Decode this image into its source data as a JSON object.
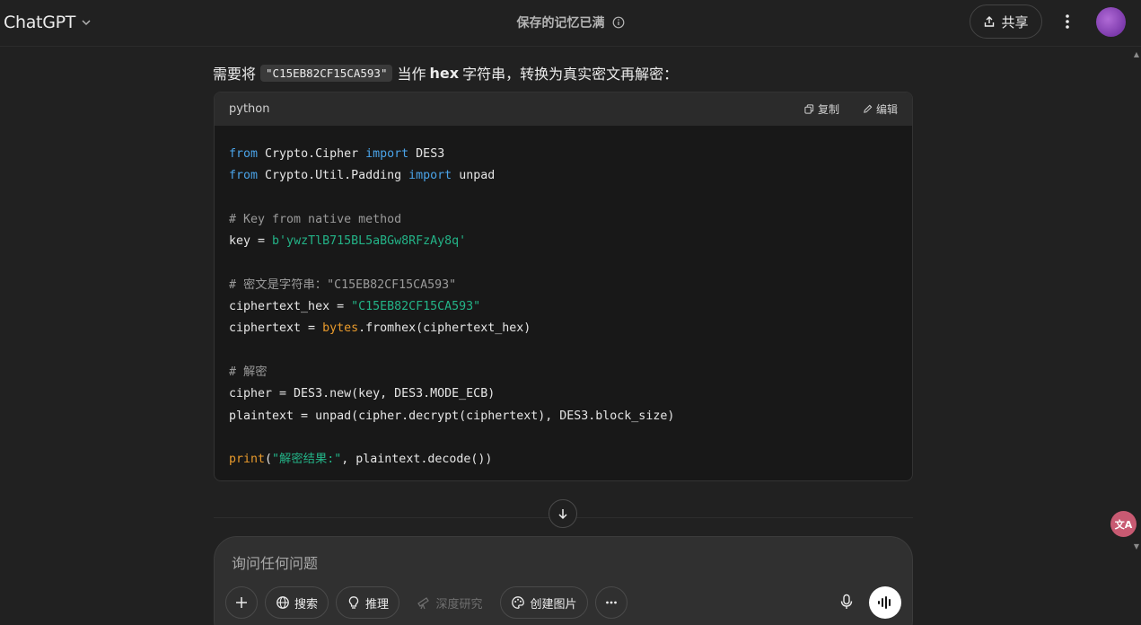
{
  "header": {
    "brand": "ChatGPT",
    "center_title": "保存的记忆已满",
    "share_label": "共享"
  },
  "message": {
    "intro_prefix": "需要将",
    "intro_code": "\"C15EB82CF15CA593\"",
    "intro_mid": "当作",
    "intro_bold": "hex",
    "intro_suffix": "字符串，转换为真实密文再解密："
  },
  "codeblock": {
    "language": "python",
    "copy_label": "复制",
    "edit_label": "编辑",
    "lines": [
      [
        {
          "t": "from",
          "c": "kw"
        },
        {
          "t": " Crypto.Cipher "
        },
        {
          "t": "import",
          "c": "kw"
        },
        {
          "t": " DES3"
        }
      ],
      [
        {
          "t": "from",
          "c": "kw"
        },
        {
          "t": " Crypto.Util.Padding "
        },
        {
          "t": "import",
          "c": "kw"
        },
        {
          "t": " unpad"
        }
      ],
      [],
      [
        {
          "t": "# Key from native method",
          "c": "cm"
        }
      ],
      [
        {
          "t": "key = "
        },
        {
          "t": "b'ywzTlB715BL5aBGw8RFzAy8q'",
          "c": "str"
        }
      ],
      [],
      [
        {
          "t": "# 密文是字符串：\"C15EB82CF15CA593\"",
          "c": "cm"
        }
      ],
      [
        {
          "t": "ciphertext_hex = "
        },
        {
          "t": "\"C15EB82CF15CA593\"",
          "c": "str"
        }
      ],
      [
        {
          "t": "ciphertext = "
        },
        {
          "t": "bytes",
          "c": "bi"
        },
        {
          "t": ".fromhex(ciphertext_hex)"
        }
      ],
      [],
      [
        {
          "t": "# 解密",
          "c": "cm"
        }
      ],
      [
        {
          "t": "cipher = DES3.new(key, DES3.MODE_ECB)"
        }
      ],
      [
        {
          "t": "plaintext = unpad(cipher.decrypt(ciphertext), DES3.block_size)"
        }
      ],
      [],
      [
        {
          "t": "print",
          "c": "bi"
        },
        {
          "t": "("
        },
        {
          "t": "\"解密结果:\"",
          "c": "str"
        },
        {
          "t": ", plaintext.decode())"
        }
      ]
    ]
  },
  "composer": {
    "placeholder": "询问任何问题",
    "tools": {
      "search": "搜索",
      "reason": "推理",
      "deep_research": "深度研究",
      "create_image": "创建图片"
    }
  },
  "translate_badge": "文A",
  "colors": {
    "keyword": "#4aa3e8",
    "string": "#23b387",
    "comment": "#9a9a9a",
    "builtin": "#e89a2c"
  }
}
